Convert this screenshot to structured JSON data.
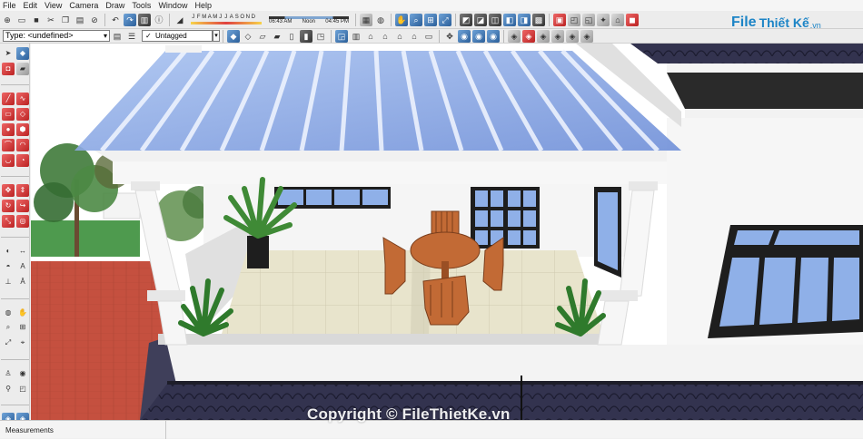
{
  "menu": [
    "File",
    "Edit",
    "View",
    "Camera",
    "Draw",
    "Tools",
    "Window",
    "Help"
  ],
  "shadow": {
    "months": [
      "J",
      "F",
      "M",
      "A",
      "M",
      "J",
      "J",
      "A",
      "S",
      "O",
      "N",
      "D"
    ],
    "time_start": "06:43 AM",
    "time_mid": "Noon",
    "time_end": "04:45 PM"
  },
  "entity_type": "Type: <undefined>",
  "tag": {
    "check": "✓",
    "label": "Untagged"
  },
  "logo": {
    "file": "File",
    "brand": "Thiết Kế",
    "tld": ".vn"
  },
  "status": {
    "measurements_label": "Measurements"
  },
  "watermark": "Copyright © FileThietKe.vn",
  "toolbar_icons": {
    "row1": [
      "new-icon",
      "open-icon",
      "save-icon",
      "cut-icon",
      "copy-icon",
      "paste-icon",
      "erase-icon",
      "undo-icon",
      "redo-icon",
      "print-icon",
      "model-info-icon",
      "shadow-toggle-icon",
      "fog-icon",
      "orbit-icon",
      "pan-icon",
      "zoom-icon",
      "zoom-window-icon",
      "zoom-extents-icon",
      "xray-icon",
      "back-edges-icon",
      "wireframe-icon",
      "hidden-line-icon",
      "shaded-icon",
      "textured-icon",
      "monochrome-icon",
      "section-plane-icon",
      "section-display-icon",
      "extension-warehouse-icon",
      "3d-warehouse-icon",
      "layout-icon"
    ],
    "row2": [
      "iso-view-icon",
      "top-view-icon",
      "front-view-icon",
      "right-view-icon",
      "back-view-icon",
      "left-view-icon",
      "style-1-icon",
      "style-2-icon",
      "style-3-icon",
      "style-4-icon",
      "house-1-icon",
      "house-2-icon",
      "house-3-icon",
      "house-4-icon",
      "house-5-icon",
      "axes-icon",
      "camera-1-icon",
      "camera-2-icon",
      "camera-3-icon",
      "sandbox-1-icon",
      "sandbox-2-icon",
      "sandbox-3-icon",
      "sandbox-4-icon",
      "sandbox-5-icon",
      "sandbox-6-icon"
    ]
  },
  "colors": {
    "roof_glass": "#7f9fd8",
    "wall": "#f6f6f6",
    "floor_tile": "#e6e2c9",
    "lawn": "#4e9a4e",
    "brick": "#c5503f",
    "roof_tile": "#2c2c48",
    "window_glass": "#8fb0e8",
    "frame": "#1e1e1e",
    "wood": "#c26a35"
  }
}
